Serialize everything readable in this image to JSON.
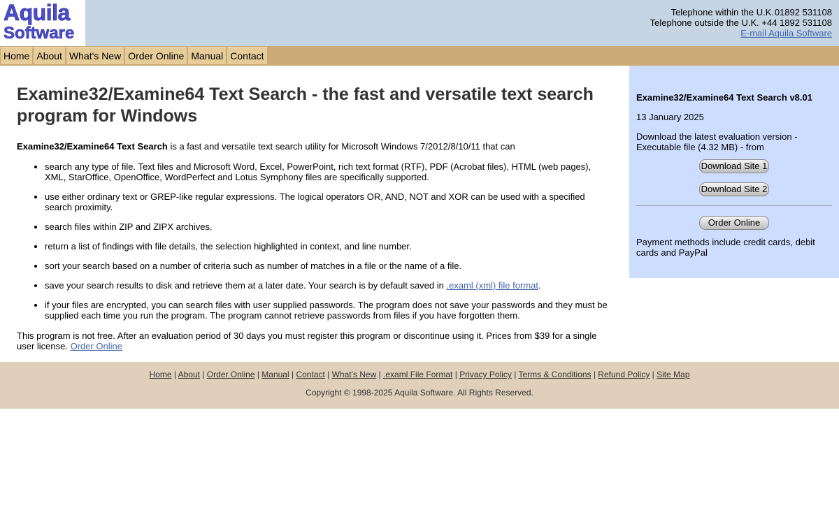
{
  "logo": {
    "line1": "Aquila",
    "line2": "Software"
  },
  "contact": {
    "uk_label": "Telephone within the U.K.",
    "uk_number": "01892 531108",
    "intl_label": "Telephone outside the U.K.",
    "intl_number": "+44 1892 531108",
    "email_link": "E-mail Aquila Software"
  },
  "nav": [
    "Home",
    "About",
    "What's New",
    "Order Online",
    "Manual",
    "Contact"
  ],
  "main": {
    "title": "Examine32/Examine64 Text Search - the fast and versatile text search program for Windows",
    "intro_bold": "Examine32/Examine64 Text Search",
    "intro_rest": " is a fast and versatile text search utility for Microsoft Windows 7/2012/8/10/11 that can",
    "bullets": [
      "search any type of file. Text files and Microsoft Word, Excel, PowerPoint, rich text format (RTF), PDF (Acrobat files), HTML (web pages), XML, StarOffice, OpenOffice, WordPerfect and Lotus Symphony files are specifically supported.",
      "use either ordinary text or GREP-like regular expressions. The logical operators OR, AND, NOT and XOR can be used with a specified search proximity.",
      "search files within ZIP and ZIPX archives.",
      "return a list of findings with file details, the selection highlighted in context, and line number.",
      "sort your search based on a number of criteria such as number of matches in a file or the name of a file.",
      "if your files are encrypted, you can search files with user supplied passwords. The program does not save your passwords and they must be supplied each time you run the program. The program cannot retrieve passwords from files if you have forgotten them."
    ],
    "save_bullet_text": "save your search results to disk and retrieve them at a later date. Your search is by default saved in ",
    "save_bullet_link": ".examl (xml) file format",
    "save_bullet_end": ".",
    "closing_text": "This program is not free. After an evaluation period of 30 days you must register this program or discontinue using it. Prices from $39 for a single user license. ",
    "closing_link": "Order Online"
  },
  "sidebar": {
    "version": "Examine32/Examine64 Text Search v8.01",
    "date": "13 January 2025",
    "download_text": "Download the latest evaluation version - Executable file (4.32 MB) - from",
    "download1": "Download Site 1",
    "download2": "Download Site 2",
    "order": "Order Online",
    "payment": "Payment methods include credit cards, debit cards and PayPal"
  },
  "footer": {
    "links": [
      "Home",
      "About",
      "Order Online",
      "Manual",
      "Contact",
      "What's New",
      ".examl File Format",
      "Privacy Policy",
      "Terms & Conditions",
      "Refund Policy",
      "Site Map"
    ],
    "copyright": "Copyright © 1998-2025 Aquila Software. All Rights Reserved."
  },
  "colors": {
    "header_bg": "#c6d5e4",
    "nav_bg": "#ccaa77",
    "nav_item_bg": "#e6cc99",
    "sidebar_bg": "#cdddff",
    "footer_bg": "#e0d0bb",
    "link": "#4466aa",
    "logo": "#4c4cd6"
  }
}
